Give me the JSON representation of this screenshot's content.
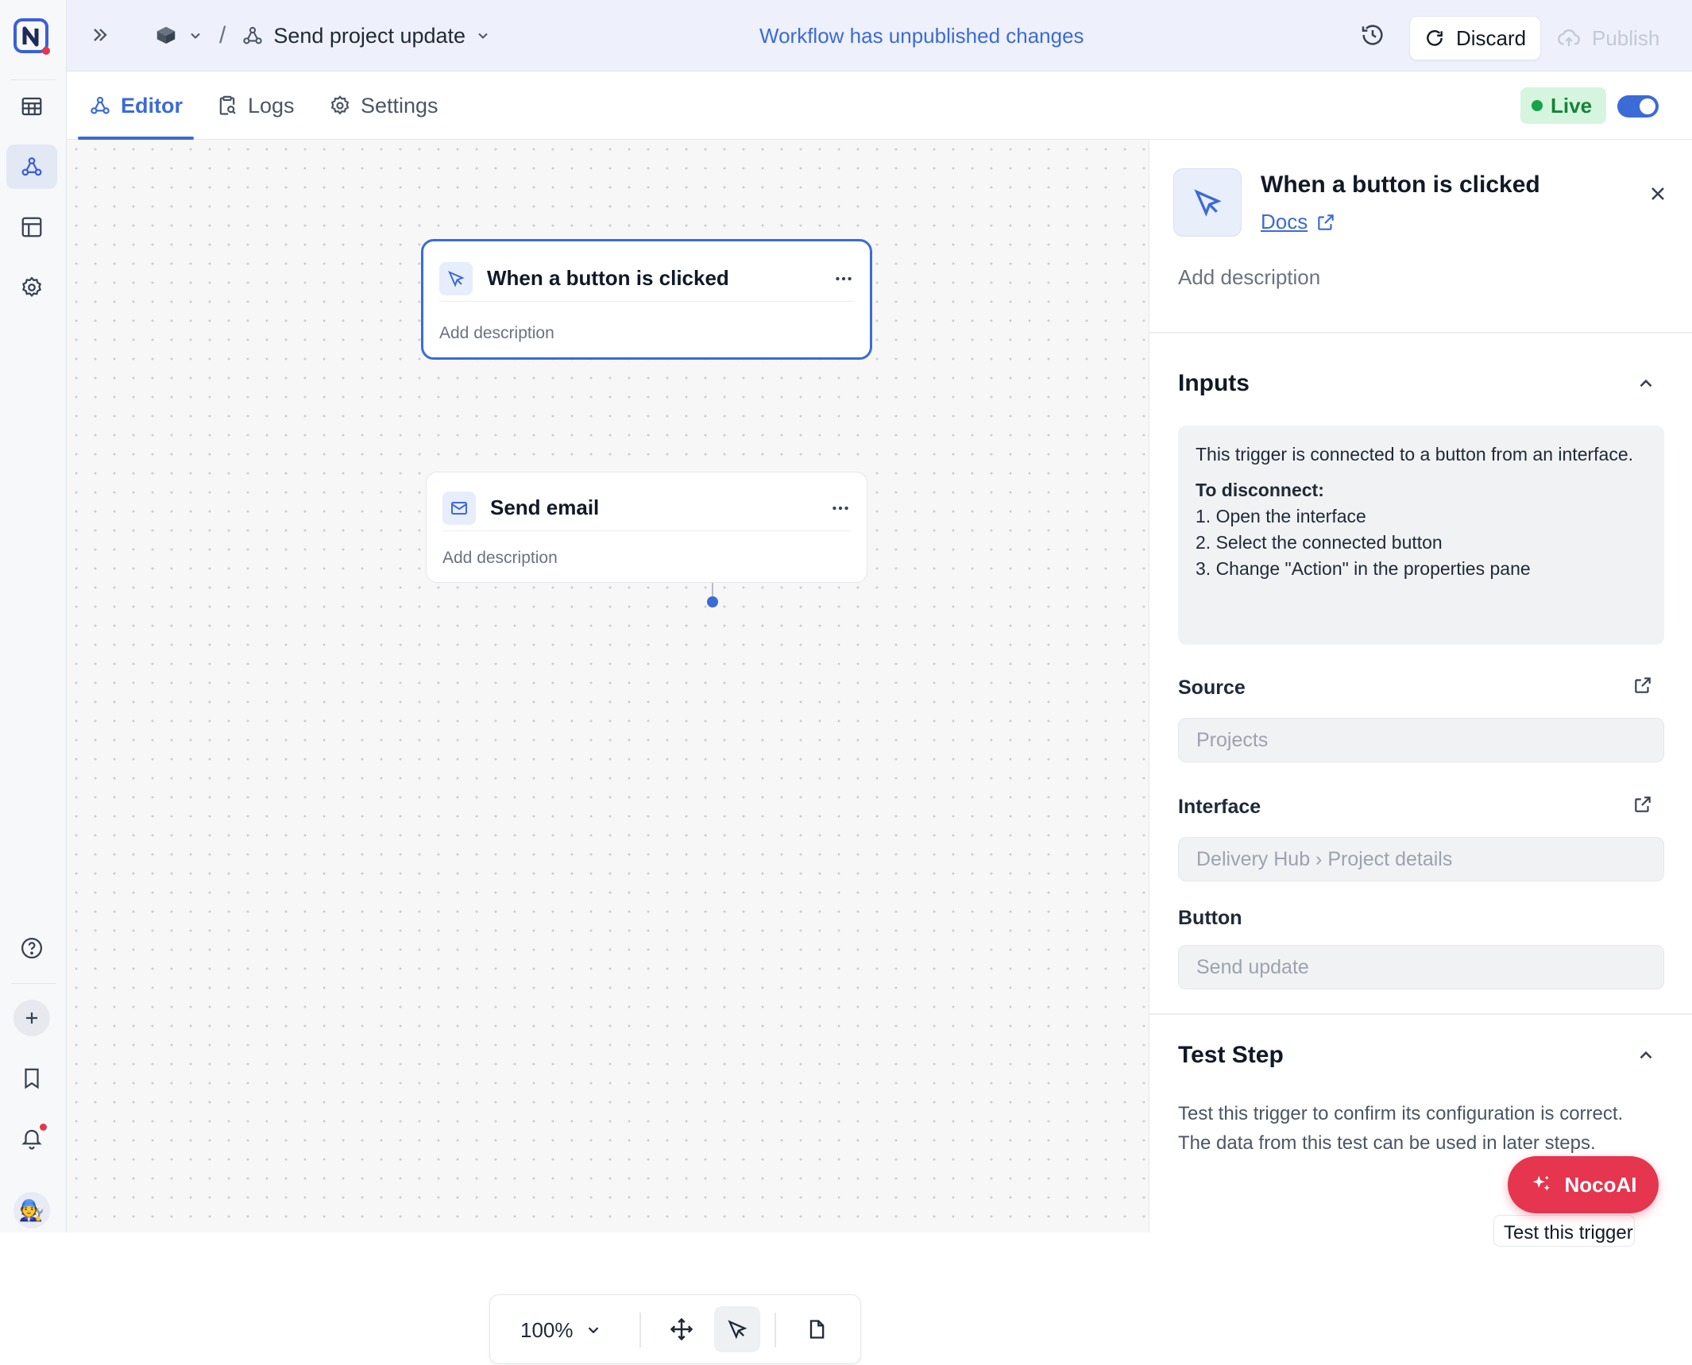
{
  "breadcrumb": {
    "workflow_name": "Send project update"
  },
  "status_message": "Workflow has unpublished changes",
  "actions": {
    "discard": "Discard",
    "publish": "Publish"
  },
  "tabs": [
    {
      "label": "Editor",
      "active": true
    },
    {
      "label": "Logs",
      "active": false
    },
    {
      "label": "Settings",
      "active": false
    }
  ],
  "live": {
    "label": "Live",
    "enabled": true
  },
  "nodes": [
    {
      "title": "When a button is clicked",
      "description": "Add description",
      "icon": "cursor-icon",
      "selected": true
    },
    {
      "title": "Send email",
      "description": "Add description",
      "icon": "mail-icon",
      "selected": false
    }
  ],
  "zoom": {
    "level": "100%"
  },
  "panel": {
    "title": "When a button is clicked",
    "docs_label": "Docs",
    "add_description": "Add description",
    "inputs_header": "Inputs",
    "info": {
      "intro": "This trigger is connected to a button from an interface.",
      "disconnect_title": "To disconnect:",
      "steps": [
        "1. Open the interface",
        "2. Select the connected button",
        "3. Change \"Action\" in the properties pane"
      ]
    },
    "fields": [
      {
        "label": "Source",
        "value": "Projects"
      },
      {
        "label": "Interface",
        "value": "Delivery Hub › Project details"
      },
      {
        "label": "Button",
        "value": "Send update"
      }
    ],
    "test_header": "Test Step",
    "test_text": "Test this trigger to confirm its configuration is correct. The data from this test can be used in later steps.",
    "test_button": "Test this trigger"
  },
  "nocoai_label": "NocoAI",
  "colors": {
    "accent": "#3b6bd6",
    "live_green": "#16a34a",
    "nocoai": "#e5354f"
  }
}
